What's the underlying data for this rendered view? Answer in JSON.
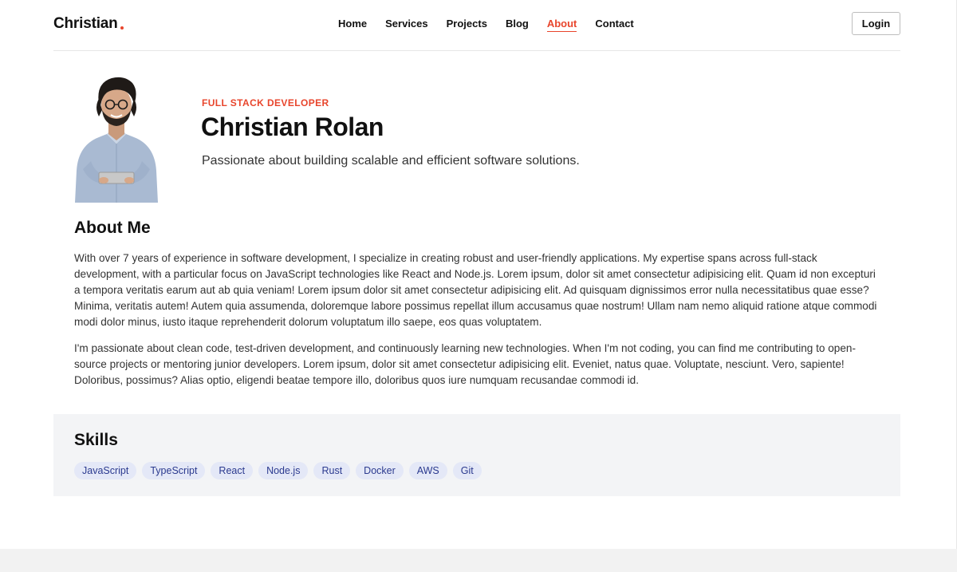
{
  "colors": {
    "accent": "#e8452c",
    "skill_bg": "#e4e8f7",
    "skill_text": "#2b3a8f",
    "section_bg": "#f3f4f6"
  },
  "navbar": {
    "brand": "Christian",
    "links": [
      "Home",
      "Services",
      "Projects",
      "Blog",
      "About",
      "Contact"
    ],
    "active": "About",
    "login_label": "Login"
  },
  "hero": {
    "role": "FULL STACK DEVELOPER",
    "name": "Christian Rolan",
    "tagline": "Passionate about building scalable and efficient software solutions."
  },
  "about": {
    "title": "About Me",
    "paragraphs": [
      "With over 7 years of experience in software development, I specialize in creating robust and user-friendly applications. My expertise spans across full-stack development, with a particular focus on JavaScript technologies like React and Node.js. Lorem ipsum, dolor sit amet consectetur adipisicing elit. Quam id non excepturi a tempora veritatis earum aut ab quia veniam! Lorem ipsum dolor sit amet consectetur adipisicing elit. Ad quisquam dignissimos error nulla necessitatibus quae esse? Minima, veritatis autem! Autem quia assumenda, doloremque labore possimus repellat illum accusamus quae nostrum! Ullam nam nemo aliquid ratione atque commodi modi dolor minus, iusto itaque reprehenderit dolorum voluptatum illo saepe, eos quas voluptatem.",
      "I'm passionate about clean code, test-driven development, and continuously learning new technologies. When I'm not coding, you can find me contributing to open-source projects or mentoring junior developers. Lorem ipsum, dolor sit amet consectetur adipisicing elit. Eveniet, natus quae. Voluptate, nesciunt. Vero, sapiente! Doloribus, possimus? Alias optio, eligendi beatae tempore illo, doloribus quos iure numquam recusandae commodi id."
    ]
  },
  "skills": {
    "title": "Skills",
    "items": [
      "JavaScript",
      "TypeScript",
      "React",
      "Node.js",
      "Rust",
      "Docker",
      "AWS",
      "Git"
    ]
  }
}
